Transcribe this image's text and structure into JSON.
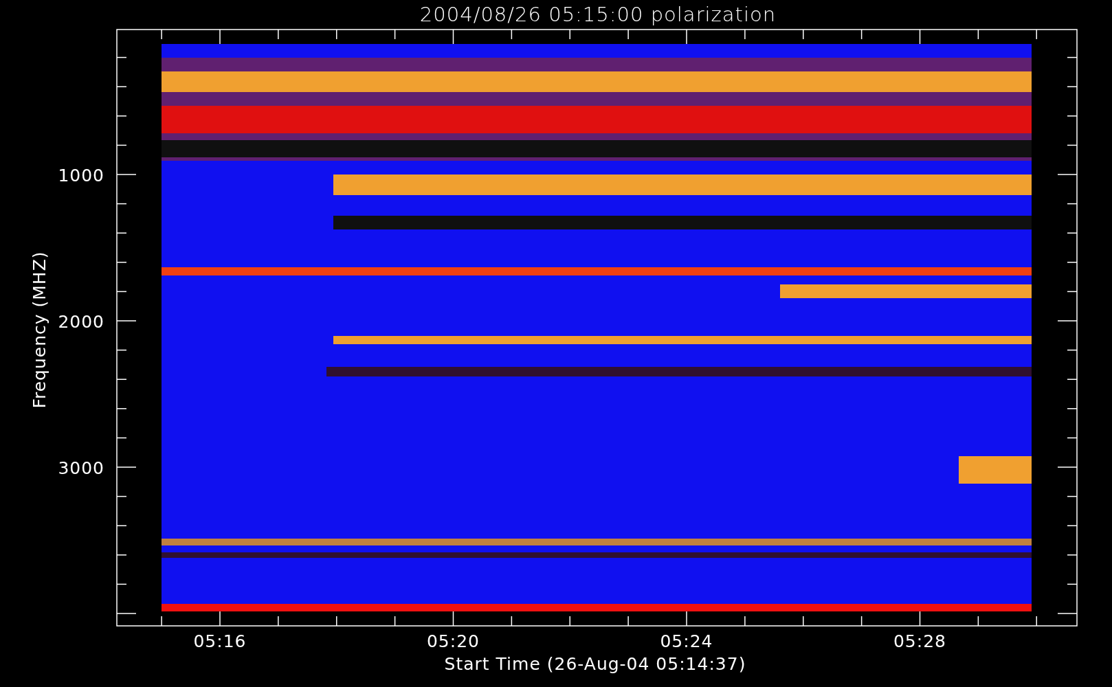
{
  "title": "2004/08/26 05:15:00 polarization",
  "y_axis": {
    "label": "Frequency (MHZ)",
    "ticks": [
      "1000",
      "2000",
      "3000"
    ]
  },
  "x_axis": {
    "label": "Start Time (26-Aug-04 05:14:37)",
    "ticks": [
      "05:16",
      "05:20",
      "05:24",
      "05:28"
    ]
  }
}
